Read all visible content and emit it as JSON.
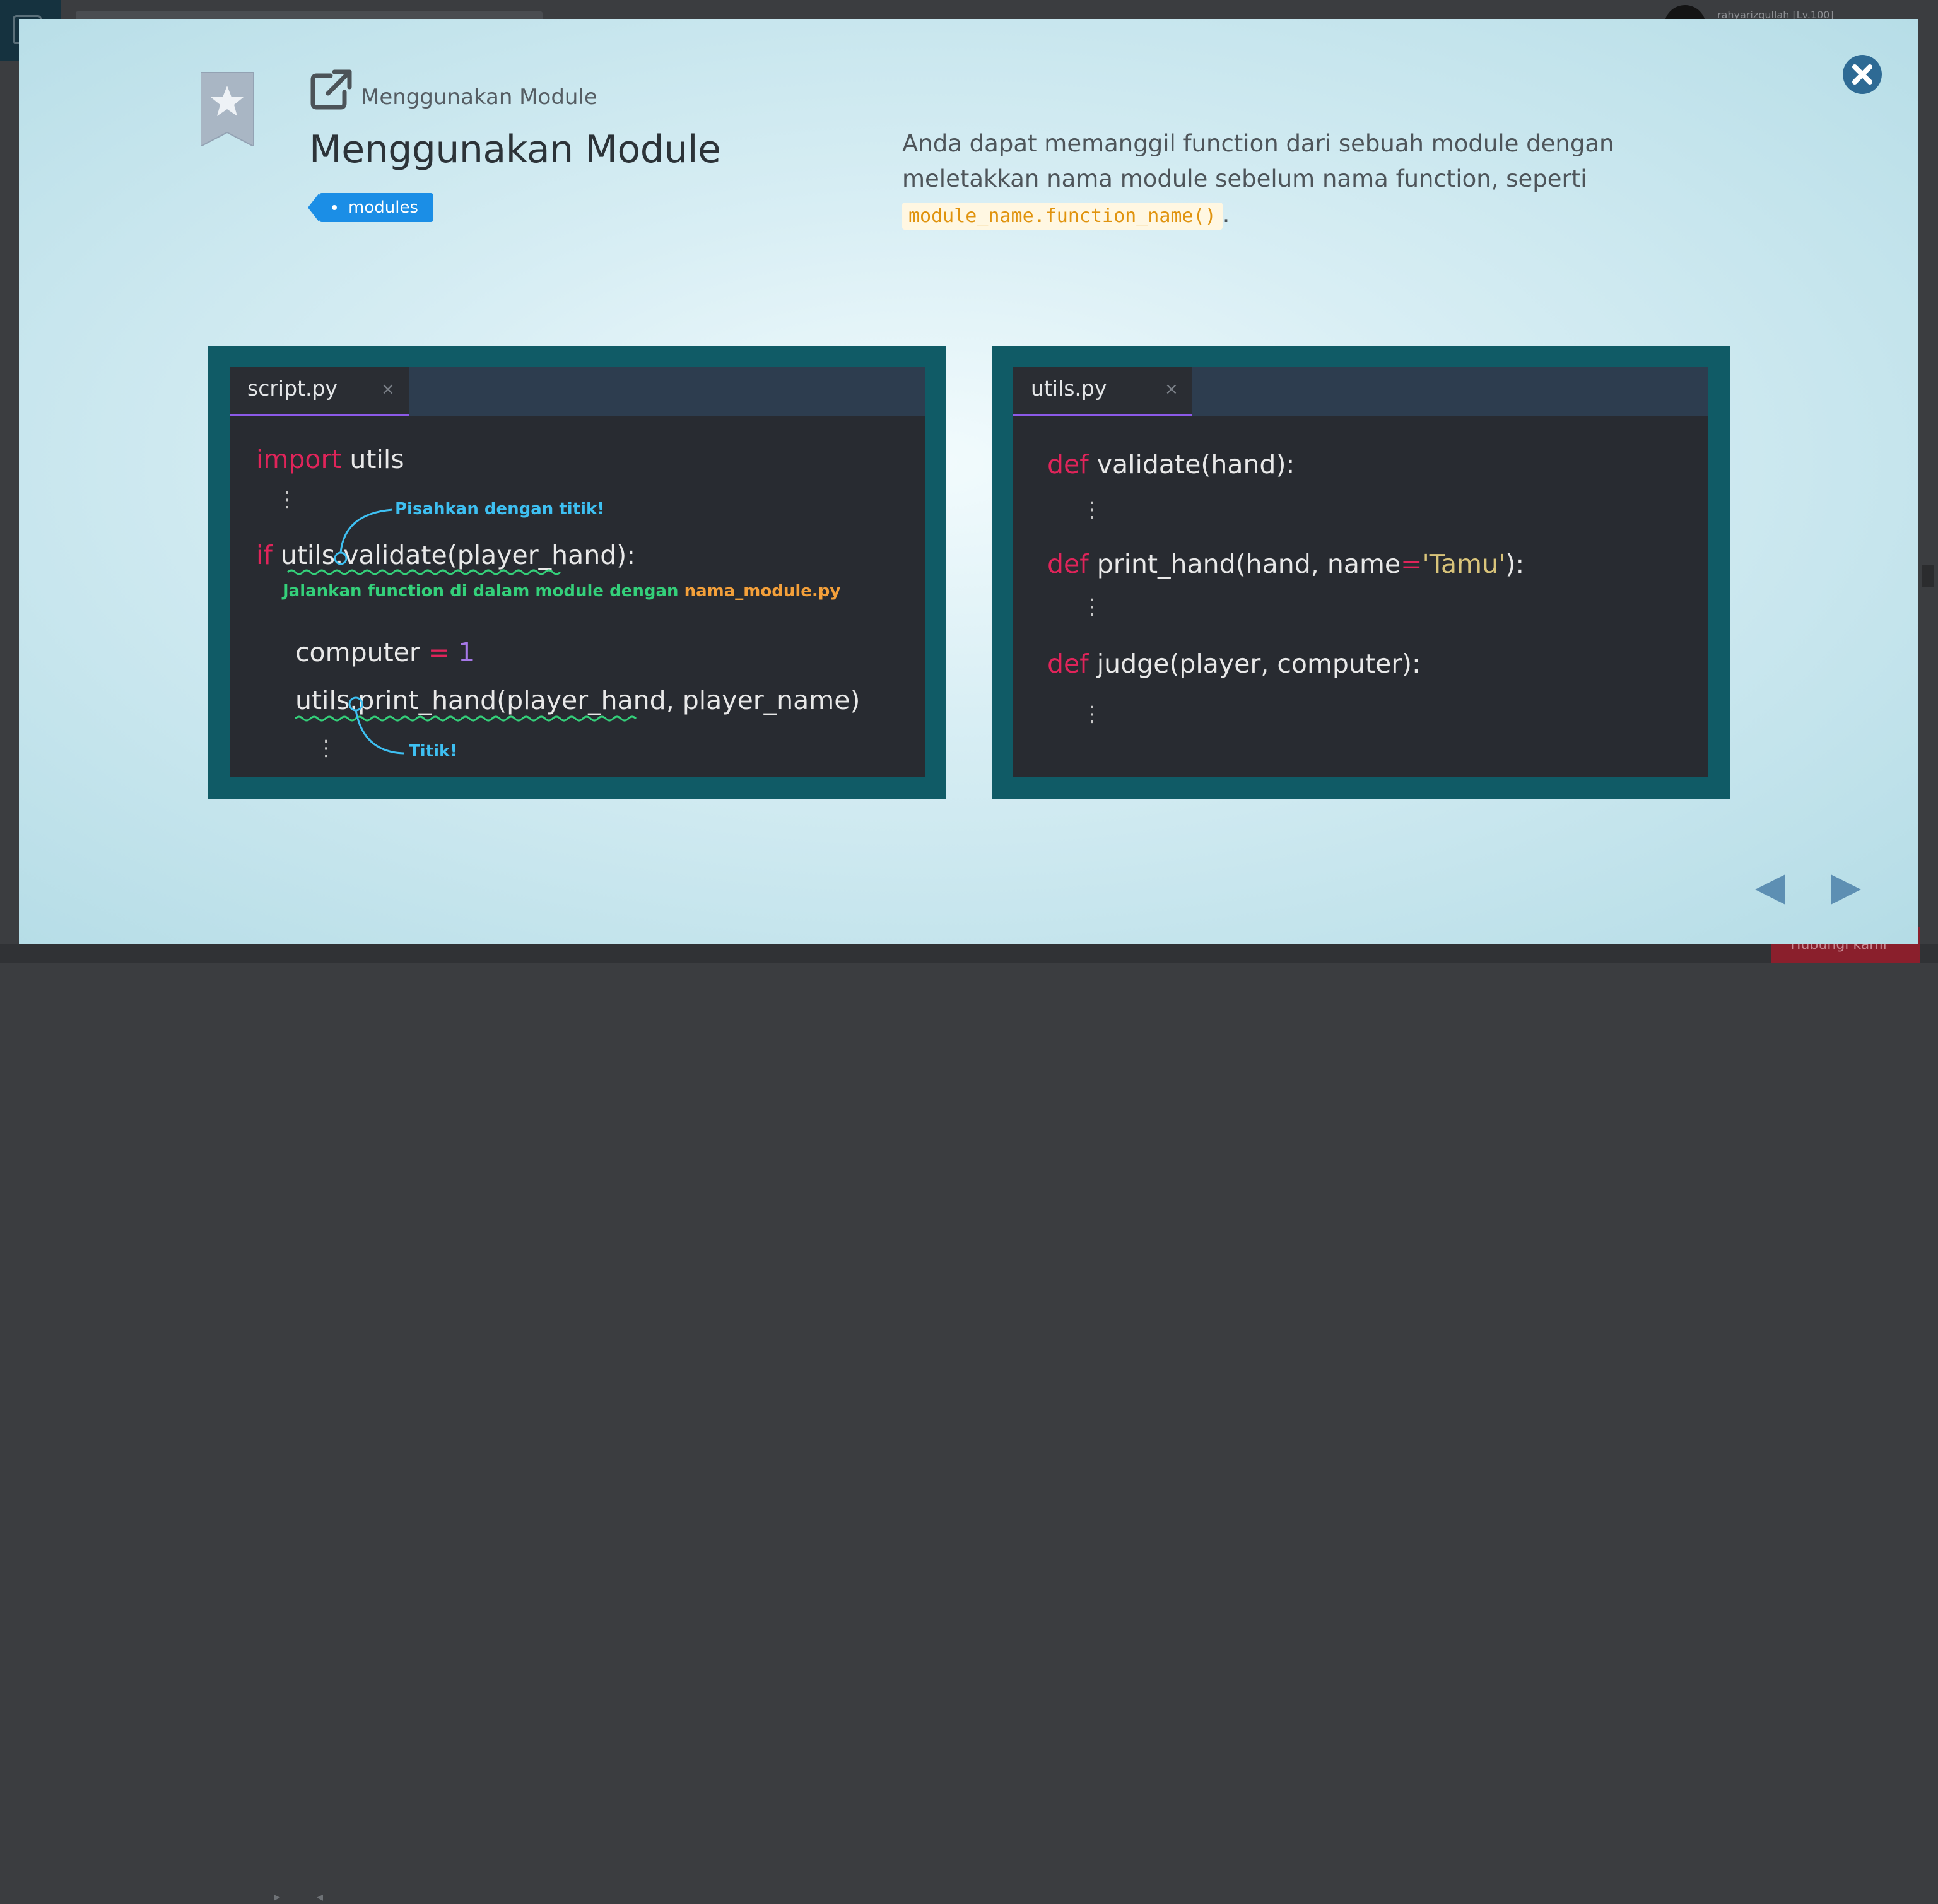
{
  "background": {
    "username": "rahyarizqullah [Lv.100]",
    "bottom_button_label": "Hubungi kami"
  },
  "modal": {
    "breadcrumb": "Menggunakan Module",
    "title": "Menggunakan Module",
    "tag": "modules",
    "description": {
      "text": "Anda dapat memanggil function dari sebuah module dengan meletakkan nama module sebelum nama function, seperti ",
      "code": "module_name.function_name()",
      "suffix": "."
    }
  },
  "slide_left": {
    "tab": "script.py",
    "tab_close": "×",
    "lines": {
      "l1_kw": "import",
      "l1_rest": " utils",
      "dots1": "⋮",
      "l2_kw": "if",
      "l2_rest": " utils.validate(player_hand):",
      "l3_name": "computer",
      "l3_op": " = ",
      "l3_num": "1",
      "l4": "utils.print_hand(player_hand, player_name)",
      "dots2": "⋮"
    },
    "notes": {
      "dot_note": "Pisahkan dengan titik!",
      "run_note": "Jalankan function di dalam module dengan ",
      "run_note_module": "nama_module.py",
      "titik_note": "Titik!"
    }
  },
  "slide_right": {
    "tab": "utils.py",
    "tab_close": "×",
    "lines": {
      "kw": "def",
      "d1": " validate(hand):",
      "d2_a": " print_hand(hand, name",
      "d2_op": "=",
      "d2_str": "'Tamu'",
      "d2_b": "):",
      "d3": " judge(player, computer):",
      "dots": "⋮"
    }
  },
  "colors": {
    "accent_tag": "#1b8ee6",
    "panel_frame": "#105b66",
    "keyword": "#e0245a",
    "close_button": "#2e6a94",
    "nav_arrow": "#5d8fb3"
  },
  "icons": {
    "bookmark": "bookmark-star-icon",
    "external_link": "external-link-icon",
    "close": "close-circle-icon",
    "prev": "triangle-left-icon",
    "next": "triangle-right-icon"
  }
}
